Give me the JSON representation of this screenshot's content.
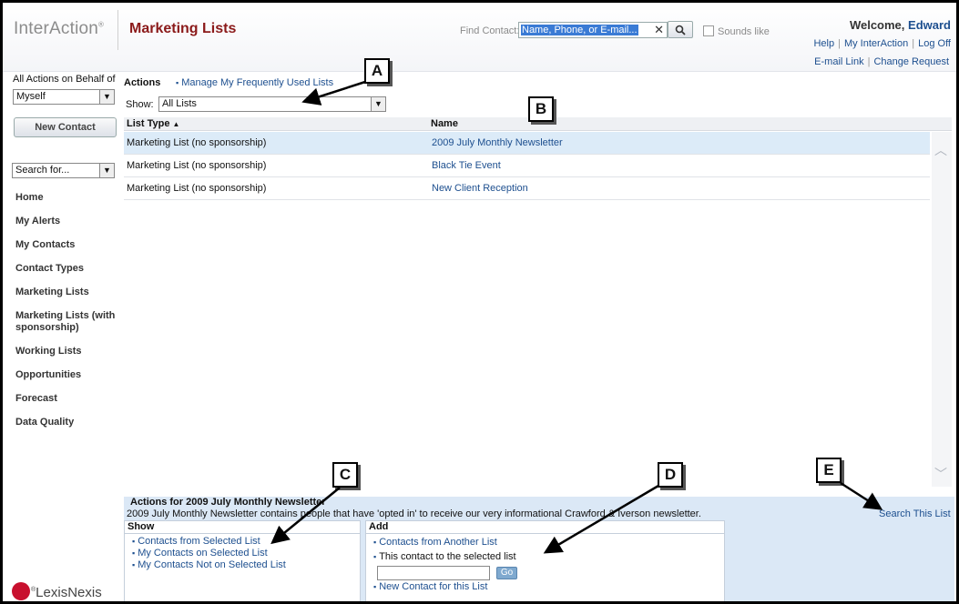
{
  "header": {
    "logo_text": "InterAction",
    "logo_mark": "®",
    "page_title": "Marketing Lists",
    "find_label": "Find Contact:",
    "find_placeholder": "Name, Phone, or E-mail...",
    "clear_glyph": "✕",
    "sounds_like": "Sounds like",
    "welcome_prefix": "Welcome,",
    "welcome_user": "Edward",
    "links": [
      "Help",
      "My InterAction",
      "Log Off"
    ],
    "links2": [
      "E-mail Link",
      "Change Request"
    ]
  },
  "sidebar": {
    "behalf_label": "All Actions on Behalf of",
    "behalf_value": "Myself",
    "new_contact": "New Contact",
    "search_for": "Search for...",
    "nav": [
      "Home",
      "My Alerts",
      "My Contacts",
      "Contact Types",
      "Marketing Lists",
      "Marketing Lists (with sponsorship)",
      "Working Lists",
      "Opportunities",
      "Forecast",
      "Data Quality"
    ]
  },
  "main": {
    "actions_label": "Actions",
    "manage_link": "Manage My Frequently Used Lists",
    "show_label": "Show:",
    "show_value": "All Lists",
    "col_list_type": "List Type",
    "sort_glyph": "▲",
    "col_name": "Name",
    "rows": [
      {
        "type": "Marketing List (no sponsorship)",
        "name": "2009 July Monthly Newsletter"
      },
      {
        "type": "Marketing List (no sponsorship)",
        "name": "Black Tie Event"
      },
      {
        "type": "Marketing List (no sponsorship)",
        "name": "New Client Reception"
      }
    ]
  },
  "bottom": {
    "title": "Actions for 2009 July Monthly Newsletter",
    "description": "2009 July Monthly Newsletter contains people that have 'opted in' to receive our very informational Crawford & Iverson newsletter.",
    "search_list": "Search This List",
    "show_head": "Show",
    "show_items": [
      "Contacts from Selected List",
      "My Contacts on Selected List",
      "My Contacts Not on Selected List"
    ],
    "add_head": "Add",
    "add_link1": "Contacts from Another List",
    "add_text": "This contact to the selected list",
    "go": "Go",
    "add_link2": "New Contact for this List"
  },
  "footer": {
    "brand": "LexisNexis",
    "brand_mark": "®"
  },
  "callouts": [
    "A",
    "B",
    "C",
    "D",
    "E"
  ]
}
